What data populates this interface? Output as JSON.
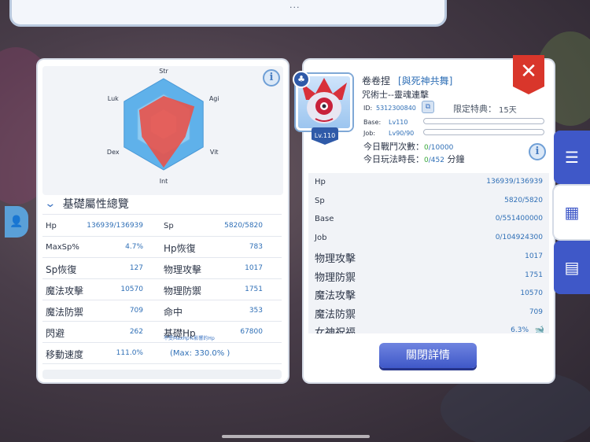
{
  "top_banner": {
    "dots": "..."
  },
  "left_panel": {
    "radar": {
      "axes": [
        "Str",
        "Agi",
        "Vit",
        "Int",
        "Dex",
        "Luk"
      ]
    },
    "section_title": "基礎屬性總覽",
    "stats": [
      {
        "l_label": "Hp",
        "l_value": "136939/136939",
        "r_label": "Sp",
        "r_value": "5820/5820"
      },
      {
        "l_label": "MaxSp%",
        "l_value": "4.7%",
        "r_label": "Hp恢復",
        "r_value": "783"
      },
      {
        "l_label": "Sp恢復",
        "l_value": "127",
        "r_label": "物理攻擊",
        "r_value": "1017"
      },
      {
        "l_label": "魔法攻擊",
        "l_value": "10570",
        "r_label": "物理防禦",
        "r_value": "1751"
      },
      {
        "l_label": "魔法防禦",
        "l_value": "709",
        "r_label": "命中",
        "r_value": "353"
      },
      {
        "l_label": "閃避",
        "l_value": "262",
        "r_label": "基礎Hp",
        "r_sublabel": "不受MaxHp%影響的Hp",
        "r_value": "67800"
      },
      {
        "l_label": "移動速度",
        "l_value": "111.0%",
        "r_label": "(Max: 330.0% )",
        "r_value": ""
      }
    ]
  },
  "right_panel": {
    "name": "卷卷捏",
    "guild": "[與死神共舞]",
    "job_title": "咒術士--靈魂連擊",
    "id_label": "ID:",
    "id_value": "5312300840",
    "privilege_label": "限定特典：",
    "privilege_value": "15天",
    "base_label": "Base:",
    "base_level": "Lv110",
    "job_label": "Job:",
    "job_level": "Lv90/90",
    "avatar_level": "Lv.110",
    "battle_label": "今日戰鬥次數：",
    "battle_value": "0",
    "battle_max": "/10000",
    "time_label": "今日玩法時長：",
    "time_value": "0",
    "time_max": "/452",
    "time_unit": "分鐘",
    "close_glyph": "✕",
    "stats": [
      {
        "label": "Hp",
        "value": "136939/136939",
        "big": false
      },
      {
        "label": "Sp",
        "value": "5820/5820",
        "big": false
      },
      {
        "label": "Base",
        "value": "0/551400000",
        "big": false
      },
      {
        "label": "Job",
        "value": "0/104924300",
        "big": false
      },
      {
        "label": "物理攻擊",
        "value": "1017",
        "big": true
      },
      {
        "label": "物理防禦",
        "value": "1751",
        "big": true
      },
      {
        "label": "魔法攻擊",
        "value": "10570",
        "big": true
      },
      {
        "label": "魔法防禦",
        "value": "709",
        "big": true
      },
      {
        "label": "女神祝福",
        "value": "6.3%",
        "big": true
      }
    ],
    "close_button": "關閉詳情"
  },
  "side_tabs": [
    "settings-sliders-icon",
    "calendar-icon",
    "id-card-icon"
  ],
  "colors": {
    "accent": "#3f58c8",
    "value_blue": "#2f6fb6",
    "close_red": "#d9362b",
    "radar_fill": "#e8524a"
  }
}
